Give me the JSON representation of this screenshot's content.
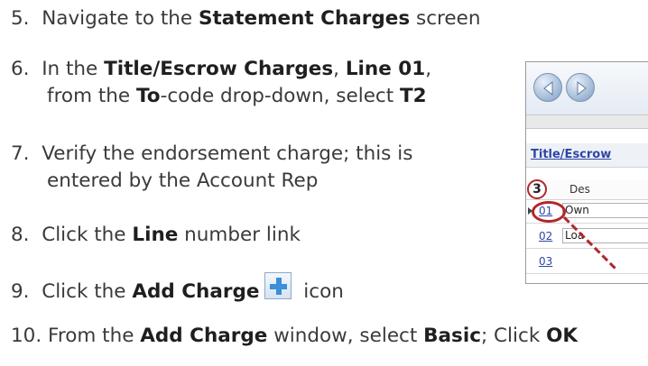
{
  "steps": [
    {
      "num": "5.",
      "pre": "Navigate to the ",
      "b1": "Statement Charges",
      "post": " screen"
    },
    {
      "num": "6.",
      "line1_pre": "In the ",
      "b1": "Title/Escrow Charges",
      "mid1": ", ",
      "b2": "Line 01",
      "mid2": ",",
      "line2_pre": "from the ",
      "b3": "To",
      "mid3": "-code drop-down, select ",
      "b4": "T2"
    },
    {
      "num": "7.",
      "line1": "Verify the endorsement charge; this is",
      "line2": "entered by the Account Rep"
    },
    {
      "num": "8.",
      "pre": "Click the ",
      "b1": "Line",
      "post": " number link"
    },
    {
      "num": "9.",
      "pre": "Click the ",
      "b1": "Add Charge",
      "post": " icon"
    },
    {
      "num": "10.",
      "pre": "From the ",
      "b1": "Add Charge",
      "mid1": " window, select ",
      "b2": "Basic",
      "mid2": "; Click ",
      "b3": "OK"
    }
  ],
  "inset": {
    "section_link": "Title/Escrow",
    "column_header": "Des",
    "step_badge": "3",
    "rows": [
      {
        "line": "01",
        "desc": "Own"
      },
      {
        "line": "02",
        "desc": "Loa"
      },
      {
        "line": "03",
        "desc": ""
      }
    ]
  },
  "icons": {
    "add_charge": "add-plus-icon",
    "nav_back": "back-arrow-icon",
    "nav_forward": "forward-arrow-icon"
  },
  "colors": {
    "link_blue": "#2f45a8",
    "callout_red": "#b1272b"
  }
}
